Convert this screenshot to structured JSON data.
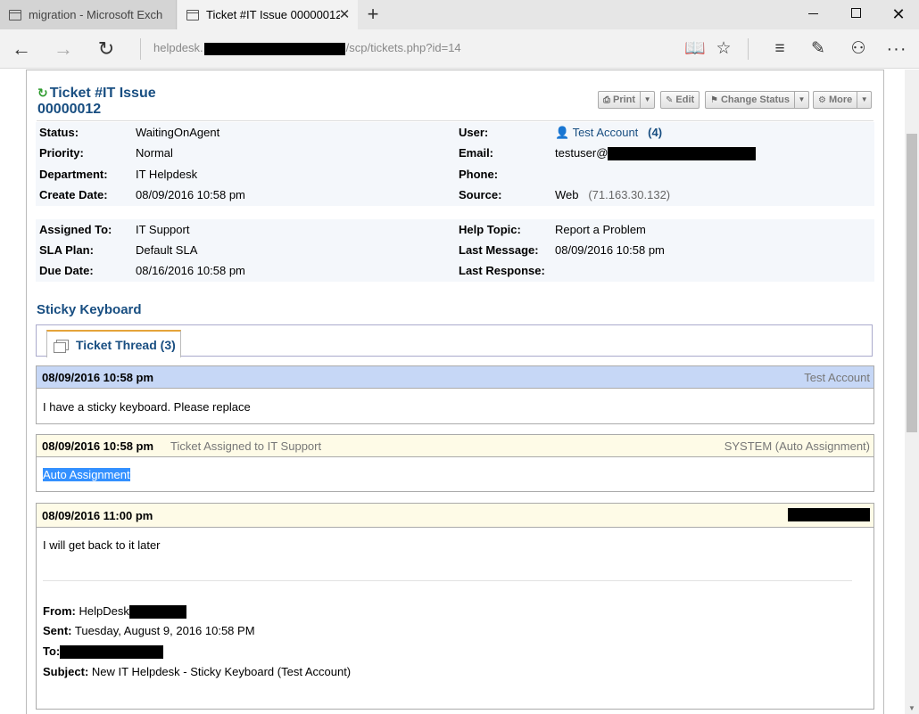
{
  "browser": {
    "tabs": [
      {
        "title": "migration - Microsoft Exchan"
      },
      {
        "title": "Ticket #IT Issue 00000012"
      }
    ],
    "address_prefix": "helpdesk.",
    "address_suffix": "/scp/tickets.php?id=14"
  },
  "ticket": {
    "title_line1": "Ticket #IT Issue",
    "title_line2": "00000012",
    "actions": {
      "print": "Print",
      "edit": "Edit",
      "change_status": "Change Status",
      "more": "More"
    },
    "details": {
      "status_label": "Status:",
      "status": "WaitingOnAgent",
      "priority_label": "Priority:",
      "priority": "Normal",
      "department_label": "Department:",
      "department": "IT Helpdesk",
      "create_date_label": "Create Date:",
      "create_date": "08/09/2016 10:58 pm",
      "user_label": "User:",
      "user": "Test Account",
      "user_count": "(4)",
      "email_label": "Email:",
      "email_prefix": "testuser@",
      "phone_label": "Phone:",
      "source_label": "Source:",
      "source": "Web",
      "source_ip": "(71.163.30.132)"
    },
    "assignment": {
      "assigned_to_label": "Assigned To:",
      "assigned_to": "IT Support",
      "sla_label": "SLA Plan:",
      "sla": "Default SLA",
      "due_label": "Due Date:",
      "due": "08/16/2016 10:58 pm",
      "help_topic_label": "Help Topic:",
      "help_topic": "Report a Problem",
      "last_message_label": "Last Message:",
      "last_message": "08/09/2016 10:58 pm",
      "last_response_label": "Last Response:"
    },
    "subject": "Sticky Keyboard",
    "thread_tab": "Ticket Thread (3)",
    "entries": [
      {
        "date": "08/09/2016 10:58 pm",
        "poster": "Test Account",
        "body": "I have a sticky keyboard.  Please replace"
      },
      {
        "date": "08/09/2016 10:58 pm",
        "desc": "Ticket Assigned to IT Support",
        "poster": "SYSTEM (Auto Assignment)",
        "body": "Auto Assignment"
      },
      {
        "date": "08/09/2016 11:00 pm",
        "body": "I will get back to it later",
        "from_label": "From:",
        "from": "HelpDesk",
        "sent_label": "Sent:",
        "sent": "Tuesday, August 9, 2016 10:58 PM",
        "to_label": "To:",
        "subject_label": "Subject:",
        "subject": "New IT Helpdesk - Sticky Keyboard (Test Account)"
      }
    ]
  },
  "colors": {
    "link": "#184e81",
    "entry_head_user": "#c6d7f6",
    "entry_head_staff": "#fefbe7",
    "selection": "#3390ff"
  }
}
